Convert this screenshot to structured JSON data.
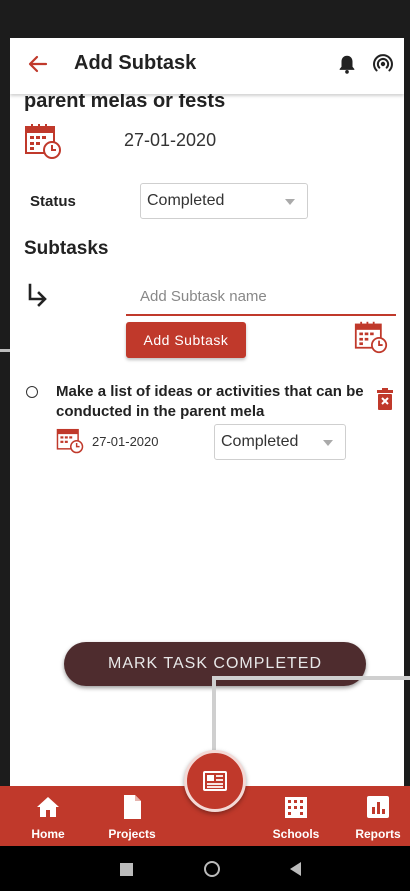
{
  "header": {
    "title": "Add Subtask"
  },
  "task": {
    "title_fragment": "parent melas or fests",
    "date": "27-01-2020",
    "status_label": "Status",
    "status_value": "Completed"
  },
  "subtasks": {
    "heading": "Subtasks",
    "input_placeholder": "Add Subtask name",
    "add_button_label": "Add Subtask",
    "items": [
      {
        "title": "Make a list of ideas or activities that can be conducted in the parent mela",
        "date": "27-01-2020",
        "status": "Completed"
      }
    ]
  },
  "mark_button_label": "MARK TASK COMPLETED",
  "bottom_nav": {
    "items": [
      {
        "label": "Home",
        "icon": "home-icon"
      },
      {
        "label": "Projects",
        "icon": "document-icon"
      },
      {
        "label": "Schools",
        "icon": "building-icon"
      },
      {
        "label": "Reports",
        "icon": "bar-chart-icon"
      }
    ],
    "fab_icon": "newspaper-icon"
  },
  "colors": {
    "accent": "#c0392b",
    "dark_button": "#4e2c2e"
  }
}
